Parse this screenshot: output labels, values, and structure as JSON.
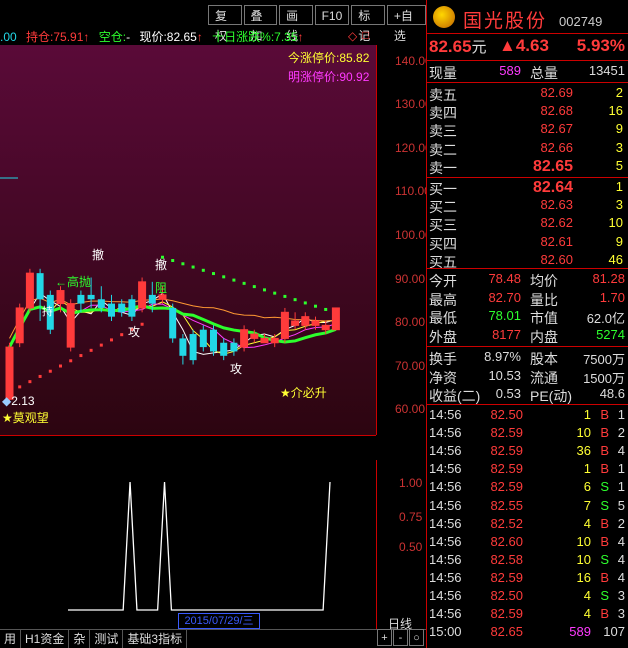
{
  "toolbar": {
    "buttons": [
      "复权",
      "叠加",
      "画线",
      "F10",
      "标记",
      "+自选"
    ]
  },
  "info_bar": {
    "prev_value": ".00",
    "position_label": "持仓:",
    "position_value": "75.91",
    "short_label": "空仓:",
    "short_value": "-",
    "price_label": "现价:",
    "price_value": "82.65",
    "ten_day_label": "十日涨跌%:",
    "ten_day_value": "7.35",
    "icon_names": [
      "up-arrow-icon",
      "diamond-icon",
      "close-icon"
    ]
  },
  "chart_labels": {
    "today_limit_label": "今涨停价:",
    "today_limit_value": "85.82",
    "tomorrow_limit_label": "明涨停价:",
    "tomorrow_limit_value": "90.92",
    "sig_high_throw": "←高抛",
    "sig_withdraw_1": "撤",
    "sig_withdraw_2": "撤",
    "sig_resist": "阻",
    "sig_attack_1": "攻",
    "sig_attack_2": "攻",
    "low_value": "2.13",
    "wait_label": "★莫观望",
    "buy_label": "★介必升",
    "misc_label": "持"
  },
  "main_axis": {
    "ticks": [
      "140.00",
      "130.00",
      "120.00",
      "110.00",
      "100.00",
      "90.00",
      "80.00",
      "70.00",
      "60.00"
    ]
  },
  "indicator_axis": {
    "ticks": [
      "1.00",
      "0.75",
      "0.50"
    ]
  },
  "date_tag": "2015/07/29/三",
  "rline_label": "日线",
  "bottom_tabs": [
    "用",
    "H1资金",
    "杂",
    "测试",
    "基础3指标"
  ],
  "corner_buttons": [
    "+",
    "-",
    "○"
  ],
  "stock": {
    "name": "国光股份",
    "code": "002749",
    "price": "82.65",
    "price_unit": "元",
    "change": "▲4.63",
    "change_pct": "5.93%"
  },
  "summary": {
    "current_vol_label": "现量",
    "current_vol": "589",
    "total_vol_label": "总量",
    "total_vol": "13451"
  },
  "sell_orders": [
    {
      "label": "卖五",
      "price": "82.69",
      "vol": "2"
    },
    {
      "label": "卖四",
      "price": "82.68",
      "vol": "16"
    },
    {
      "label": "卖三",
      "price": "82.67",
      "vol": "9"
    },
    {
      "label": "卖二",
      "price": "82.66",
      "vol": "3"
    },
    {
      "label": "卖一",
      "price": "82.65",
      "vol": "5"
    }
  ],
  "buy_orders": [
    {
      "label": "买一",
      "price": "82.64",
      "vol": "1"
    },
    {
      "label": "买二",
      "price": "82.63",
      "vol": "3"
    },
    {
      "label": "买三",
      "price": "82.62",
      "vol": "10"
    },
    {
      "label": "买四",
      "price": "82.61",
      "vol": "9"
    },
    {
      "label": "买五",
      "price": "82.60",
      "vol": "46"
    }
  ],
  "stats": [
    {
      "l1": "今开",
      "v1": "78.48",
      "c1": "#ff3b3b",
      "l2": "均价",
      "v2": "81.28",
      "c2": "#ff3b3b"
    },
    {
      "l1": "最高",
      "v1": "82.70",
      "c1": "#ff3b3b",
      "l2": "量比",
      "v2": "1.70",
      "c2": "#ff3b3b"
    },
    {
      "l1": "最低",
      "v1": "78.01",
      "c1": "#2dff2d",
      "l2": "市值",
      "v2": "62.0亿",
      "c2": "#dddddd"
    },
    {
      "l1": "外盘",
      "v1": "8177",
      "c1": "#ff3b3b",
      "l2": "内盘",
      "v2": "5274",
      "c2": "#2dff2d"
    }
  ],
  "stats2": [
    {
      "l1": "换手",
      "v1": "8.97%",
      "l2": "股本",
      "v2": "7500万"
    },
    {
      "l1": "净资",
      "v1": "10.53",
      "l2": "流通",
      "v2": "1500万"
    },
    {
      "l1": "收益(二)",
      "v1": "0.53",
      "l2": "PE(动)",
      "v2": "48.6"
    }
  ],
  "ticks": [
    {
      "time": "14:56",
      "price": "82.50",
      "vol": "1",
      "bs": "B",
      "n": "1"
    },
    {
      "time": "14:56",
      "price": "82.59",
      "vol": "10",
      "bs": "B",
      "n": "2"
    },
    {
      "time": "14:56",
      "price": "82.59",
      "vol": "36",
      "bs": "B",
      "n": "4"
    },
    {
      "time": "14:56",
      "price": "82.59",
      "vol": "1",
      "bs": "B",
      "n": "1"
    },
    {
      "time": "14:56",
      "price": "82.59",
      "vol": "6",
      "bs": "S",
      "n": "1"
    },
    {
      "time": "14:56",
      "price": "82.55",
      "vol": "7",
      "bs": "S",
      "n": "5"
    },
    {
      "time": "14:56",
      "price": "82.52",
      "vol": "4",
      "bs": "B",
      "n": "2"
    },
    {
      "time": "14:56",
      "price": "82.60",
      "vol": "10",
      "bs": "B",
      "n": "4"
    },
    {
      "time": "14:56",
      "price": "82.58",
      "vol": "10",
      "bs": "S",
      "n": "4"
    },
    {
      "time": "14:56",
      "price": "82.59",
      "vol": "16",
      "bs": "B",
      "n": "4"
    },
    {
      "time": "14:56",
      "price": "82.50",
      "vol": "4",
      "bs": "S",
      "n": "3"
    },
    {
      "time": "14:56",
      "price": "82.59",
      "vol": "4",
      "bs": "B",
      "n": "3"
    },
    {
      "time": "15:00",
      "price": "82.65",
      "vol": "589",
      "bs": "",
      "n": "107"
    }
  ],
  "candles": [
    {
      "o": 62,
      "c": 74,
      "h": 75,
      "l": 61,
      "up": true
    },
    {
      "o": 75,
      "c": 83,
      "h": 84,
      "l": 74,
      "up": true
    },
    {
      "o": 83,
      "c": 91,
      "h": 92,
      "l": 82,
      "up": true
    },
    {
      "o": 91,
      "c": 85,
      "h": 92,
      "l": 80,
      "up": false
    },
    {
      "o": 86,
      "c": 78,
      "h": 87,
      "l": 77,
      "up": false
    },
    {
      "o": 84,
      "c": 87,
      "h": 88,
      "l": 82,
      "up": true
    },
    {
      "o": 84,
      "c": 74,
      "h": 85,
      "l": 73,
      "up": true
    },
    {
      "o": 84,
      "c": 86,
      "h": 87,
      "l": 82,
      "up": false
    },
    {
      "o": 86,
      "c": 85,
      "h": 90,
      "l": 83,
      "up": false
    },
    {
      "o": 85,
      "c": 83,
      "h": 88,
      "l": 82,
      "up": false
    },
    {
      "o": 84,
      "c": 81,
      "h": 86,
      "l": 80,
      "up": false
    },
    {
      "o": 84,
      "c": 82,
      "h": 85,
      "l": 81,
      "up": false
    },
    {
      "o": 85,
      "c": 81,
      "h": 86,
      "l": 80,
      "up": false
    },
    {
      "o": 83,
      "c": 89,
      "h": 90,
      "l": 82,
      "up": true
    },
    {
      "o": 86,
      "c": 84,
      "h": 89,
      "l": 82,
      "up": false
    },
    {
      "o": 85,
      "c": 86,
      "h": 88,
      "l": 84,
      "up": true
    },
    {
      "o": 83,
      "c": 76,
      "h": 84,
      "l": 75,
      "up": false
    },
    {
      "o": 76,
      "c": 72,
      "h": 77,
      "l": 70,
      "up": false
    },
    {
      "o": 77,
      "c": 71,
      "h": 78,
      "l": 70,
      "up": false
    },
    {
      "o": 78,
      "c": 74,
      "h": 79,
      "l": 73,
      "up": false
    },
    {
      "o": 78,
      "c": 73,
      "h": 79,
      "l": 72,
      "up": false
    },
    {
      "o": 75,
      "c": 72,
      "h": 76,
      "l": 71,
      "up": false
    },
    {
      "o": 73,
      "c": 75,
      "h": 76,
      "l": 72,
      "up": false
    },
    {
      "o": 74,
      "c": 78,
      "h": 79,
      "l": 73,
      "up": true
    },
    {
      "o": 76,
      "c": 77,
      "h": 78,
      "l": 75,
      "up": true
    },
    {
      "o": 75,
      "c": 76,
      "h": 77,
      "l": 75,
      "up": true
    },
    {
      "o": 75,
      "c": 76,
      "h": 77,
      "l": 74,
      "up": true
    },
    {
      "o": 76,
      "c": 82,
      "h": 83,
      "l": 75,
      "up": true
    },
    {
      "o": 80,
      "c": 79,
      "h": 82,
      "l": 78,
      "up": true
    },
    {
      "o": 79,
      "c": 81,
      "h": 82,
      "l": 78,
      "up": true
    },
    {
      "o": 80,
      "c": 79,
      "h": 81,
      "l": 78,
      "up": true
    },
    {
      "o": 78,
      "c": 79,
      "h": 80,
      "l": 77,
      "up": true
    },
    {
      "o": 78,
      "c": 83,
      "h": 83,
      "l": 78,
      "up": true
    }
  ],
  "indicator_values": [
    0,
    0,
    0,
    0,
    0,
    0,
    0,
    0,
    0,
    1,
    0,
    0,
    0,
    0,
    1,
    0,
    0,
    0,
    0,
    0,
    0,
    0,
    0,
    0,
    0,
    0,
    0,
    0,
    0,
    0,
    0,
    0,
    0,
    0,
    0,
    0,
    0,
    0,
    1
  ],
  "colors": {
    "up": "#ff3b3b",
    "down": "#22d7e6",
    "ma_green": "#2dff2d",
    "ma_orange": "#ff9933",
    "ma_magenta": "#ff3bff",
    "ma_white": "#ffffff",
    "ma_yellow": "#ffff33",
    "axis_red": "#cc0000"
  }
}
